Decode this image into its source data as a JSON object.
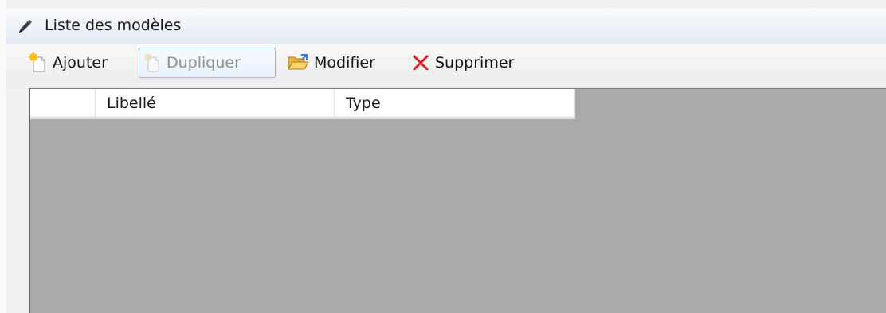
{
  "window": {
    "title": "Liste des modèles",
    "icon": "pencil-icon"
  },
  "toolbar": {
    "add_label": "Ajouter",
    "duplicate_label": "Dupliquer",
    "edit_label": "Modifier",
    "delete_label": "Supprimer"
  },
  "grid": {
    "columns": [
      "",
      "Libellé",
      "Type"
    ],
    "rows": []
  },
  "colors": {
    "grid_background": "#aaaaaa",
    "titlebar": "#e3e9f3",
    "delete_icon": "#e02020",
    "disabled_text": "#8f8f8f"
  }
}
